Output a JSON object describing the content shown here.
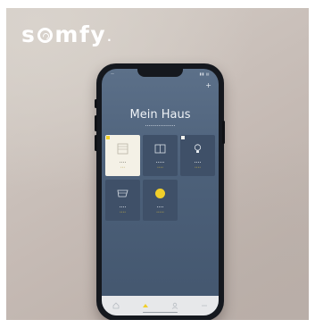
{
  "brand": {
    "logo_text": "somfy.",
    "logo_color": "#ffffff"
  },
  "phone": {
    "screen_title": "Mein Haus",
    "accent_color": "#f1cf2a",
    "tiles": [
      {
        "icon": "shutter-icon",
        "state": "active"
      },
      {
        "icon": "window-icon",
        "state": "inactive"
      },
      {
        "icon": "light-bulb-icon",
        "state": "inactive"
      },
      {
        "icon": "awning-icon",
        "state": "inactive"
      },
      {
        "icon": "sun-icon",
        "state": "inactive"
      }
    ],
    "tabs": [
      {
        "icon": "home-icon"
      },
      {
        "icon": "scenes-icon",
        "state": "selected"
      },
      {
        "icon": "user-icon"
      },
      {
        "icon": "more-icon"
      }
    ]
  }
}
